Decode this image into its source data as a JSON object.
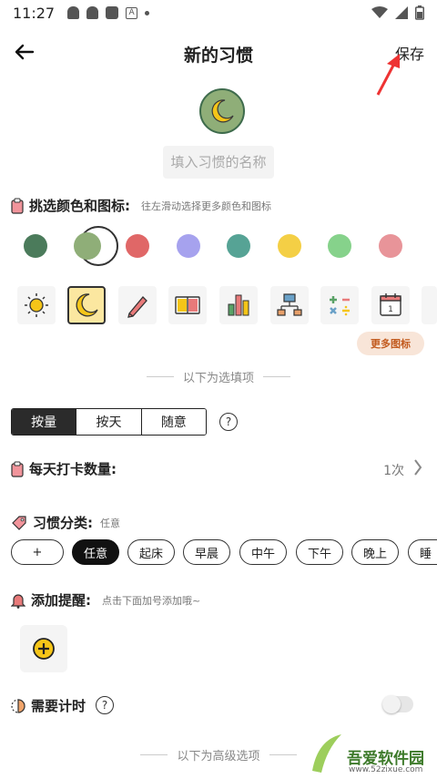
{
  "status_bar": {
    "time": "11:27"
  },
  "header": {
    "title": "新的习惯",
    "save_label": "保存"
  },
  "name_input": {
    "placeholder": "填入习惯的名称"
  },
  "color_section": {
    "title": "挑选颜色和图标:",
    "hint": "往左滑动选择更多颜色和图标"
  },
  "colors": [
    "#4b7b5b",
    "#8fae78",
    "#e06767",
    "#a6a2ee",
    "#56a395",
    "#f4cf45",
    "#86d28b",
    "#e89499"
  ],
  "selected_color": "#8fae78",
  "icons": [
    "sun-icon",
    "moon-icon",
    "pencil-icon",
    "book-icon",
    "bar-chart-icon",
    "org-chart-icon",
    "calculator-icon",
    "calendar-icon"
  ],
  "calendar_day": "1",
  "more_icons_label": "更多图标",
  "optional_divider": "以下为选填项",
  "mode_tabs": [
    "按量",
    "按天",
    "随意"
  ],
  "help_glyph": "?",
  "daily_count": {
    "title": "每天打卡数量:",
    "value": "1次"
  },
  "category": {
    "title": "习惯分类:",
    "hint": "任意",
    "chips": [
      "+",
      "任意",
      "起床",
      "早晨",
      "中午",
      "下午",
      "晚上",
      "睡"
    ]
  },
  "reminder": {
    "title": "添加提醒:",
    "hint": "点击下面加号添加哦~"
  },
  "timer": {
    "title": "需要计时"
  },
  "advanced_divider": "以下为高级选项",
  "watermark": {
    "brand": "吾爱软件园",
    "url": "www.52zixue.com"
  }
}
